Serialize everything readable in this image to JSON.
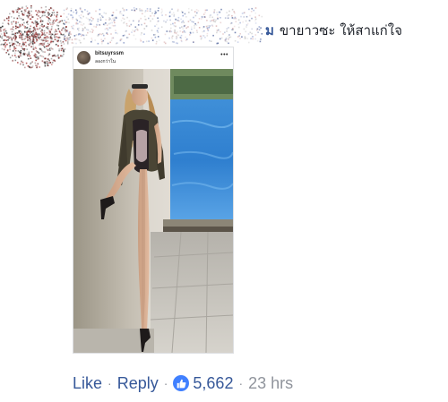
{
  "comment": {
    "author_visible": "ม",
    "text": "ขายาวซะ ให้สาแก่ใจ"
  },
  "embedded_post": {
    "username": "bitsuyrssm",
    "location": "ลองกว่าใน"
  },
  "actions": {
    "like_label": "Like",
    "separator": "·",
    "reply_label": "Reply",
    "reaction_count": "5,662",
    "timestamp": "23 hrs"
  },
  "icons": {
    "reaction": "thumbs-up-icon",
    "menu": "more-dots-icon"
  },
  "colors": {
    "link": "#365899",
    "meta": "#90949c",
    "like_badge": "#4080ff",
    "text": "#1d2129"
  }
}
